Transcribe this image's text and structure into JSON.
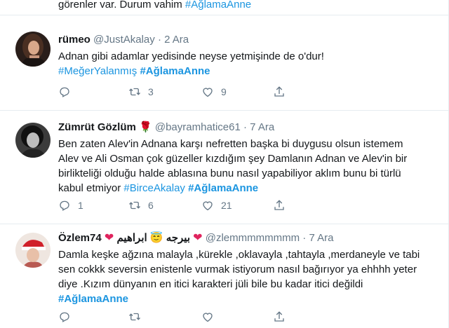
{
  "top_tweet": {
    "text": "görenler var. Durum vahim",
    "hashtag": "#AğlamaAnne"
  },
  "tweets": [
    {
      "name": "rümeo",
      "handle": "@JustAkalay",
      "date": "2 Ara",
      "text": "Adnan gibi adamlar yedisinde neyse yetmişinde de o'dur!",
      "hashtag1": "#MeğerYalanmış",
      "hashtag2": "#AğlamaAnne",
      "replies": "",
      "retweets": "3",
      "likes": "9"
    },
    {
      "name": "Zümrüt Gözlüm",
      "name_emoji": "🌹",
      "handle": "@bayramhatice61",
      "date": "7 Ara",
      "text": "Ben zaten Alev'in Adnana karşı nefretten başka bi duygusu olsun istemem Alev ve Ali Osman çok güzeller kızdığım şey Damlanın Adnan ve Alev'in bir birlikteliği olduğu halde ablasına bunu nasıl yapabiliyor aklım bunu bi türlü kabul etmiyor",
      "hashtag1": "#BirceAkalay",
      "hashtag2": "#AğlamaAnne",
      "replies": "1",
      "retweets": "6",
      "likes": "21"
    },
    {
      "name": "Özlem74",
      "name_arabic1": "بيرجه",
      "name_arabic2": "ابراهيم",
      "handle": "@zlemmmmmmmm",
      "date": "7 Ara",
      "text": "Damla keşke ağzına malayla ,kürekle ,oklavayla ,tahtayla ,merdaneyle ve tabi sen cokkk seversin enistenle vurmak istiyorum nasıl bağırıyor ya ehhhh yeter diye .Kızım dünyanın en itici karakteri jüli bile bu kadar itici değildi",
      "hashtag2": "#AğlamaAnne",
      "replies": "",
      "retweets": "",
      "likes": ""
    }
  ],
  "separator": "·",
  "colors": {
    "link": "#1b95e0",
    "muted": "#657786",
    "text": "#14171a",
    "border": "#e6ecf0"
  },
  "icons": {
    "reply": "reply-icon",
    "retweet": "retweet-icon",
    "like": "heart-icon",
    "share": "share-icon"
  }
}
